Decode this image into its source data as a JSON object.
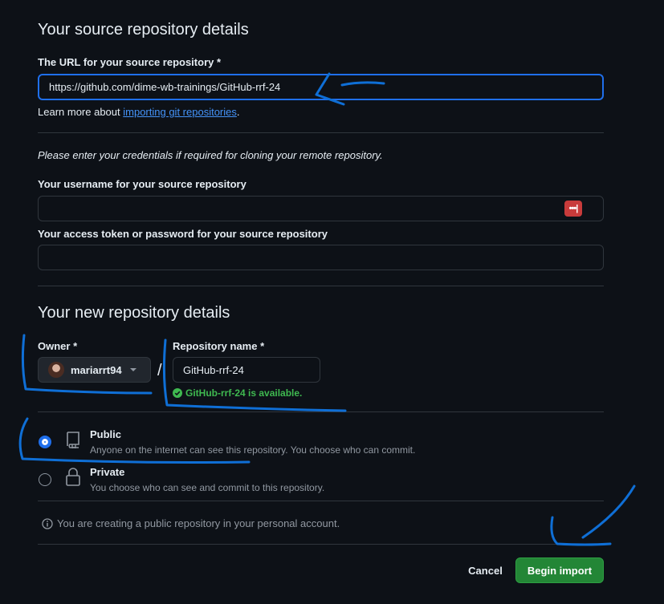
{
  "source": {
    "heading": "Your source repository details",
    "url_label": "The URL for your source repository *",
    "url_value": "https://github.com/dime-wb-trainings/GitHub-rrf-24",
    "learn_prefix": "Learn more about",
    "learn_link": "importing git repositories",
    "learn_suffix": ".",
    "credentials_note": "Please enter your credentials if required for cloning your remote repository.",
    "username_label": "Your username for your source repository",
    "username_value": "",
    "password_label": "Your access token or password for your source repository",
    "password_value": "",
    "password_manager_icon": "dots-icon"
  },
  "new_repo": {
    "heading": "Your new repository details",
    "owner_label": "Owner *",
    "owner_value": "mariarrt94",
    "separator": "/",
    "name_label": "Repository name *",
    "name_value": "GitHub-rrf-24",
    "availability": "GitHub-rrf-24 is available."
  },
  "visibility": {
    "public_title": "Public",
    "public_desc": "Anyone on the internet can see this repository. You choose who can commit.",
    "private_title": "Private",
    "private_desc": "You choose who can see and commit to this repository.",
    "selected": "public"
  },
  "info_note": "You are creating a public repository in your personal account.",
  "actions": {
    "cancel": "Cancel",
    "begin": "Begin import"
  },
  "colors": {
    "accent": "#1f6feb",
    "success": "#3fb950",
    "primary_button": "#238636",
    "annotation": "#0f6fd6"
  }
}
